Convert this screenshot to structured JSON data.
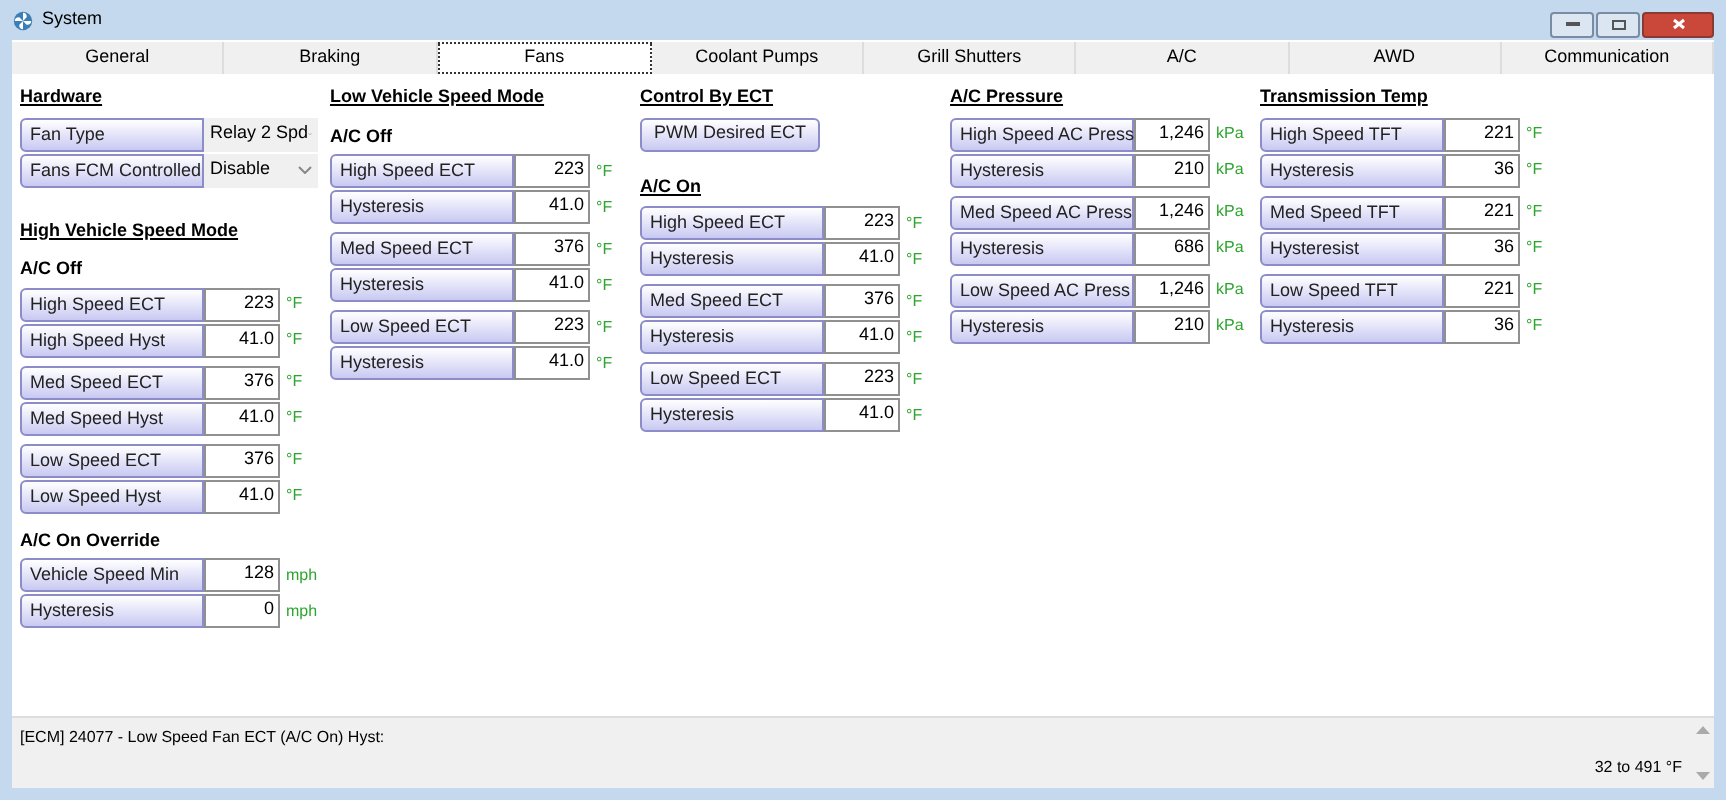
{
  "window": {
    "title": "System"
  },
  "tabs": [
    {
      "label": "General",
      "selected": false
    },
    {
      "label": "Braking",
      "selected": false
    },
    {
      "label": "Fans",
      "selected": true
    },
    {
      "label": "Coolant Pumps",
      "selected": false
    },
    {
      "label": "Grill Shutters",
      "selected": false
    },
    {
      "label": "A/C",
      "selected": false
    },
    {
      "label": "AWD",
      "selected": false
    },
    {
      "label": "Communication",
      "selected": false
    }
  ],
  "columns": [
    {
      "items": [
        {
          "kind": "section",
          "text": "Hardware"
        },
        {
          "kind": "selects",
          "rows": [
            {
              "label": "Fan Type",
              "value": "Relay 2 Spd"
            },
            {
              "label": "Fans FCM Controlled",
              "value": "Disable"
            }
          ]
        },
        {
          "kind": "section",
          "text": "High Vehicle Speed Mode"
        },
        {
          "kind": "subsection",
          "text": "A/C Off"
        },
        {
          "kind": "params",
          "rows": [
            {
              "label": "High Speed ECT",
              "value": "223",
              "unit": "°F"
            },
            {
              "label": "High Speed Hyst",
              "value": "41.0",
              "unit": "°F"
            }
          ]
        },
        {
          "kind": "params",
          "rows": [
            {
              "label": "Med Speed ECT",
              "value": "376",
              "unit": "°F"
            },
            {
              "label": "Med Speed Hyst",
              "value": "41.0",
              "unit": "°F"
            }
          ]
        },
        {
          "kind": "params",
          "rows": [
            {
              "label": "Low Speed ECT",
              "value": "376",
              "unit": "°F"
            },
            {
              "label": "Low Speed Hyst",
              "value": "41.0",
              "unit": "°F"
            }
          ]
        },
        {
          "kind": "subsection",
          "text": "A/C On Override"
        },
        {
          "kind": "params",
          "rows": [
            {
              "label": "Vehicle Speed Min",
              "value": "128",
              "unit": "mph"
            },
            {
              "label": "Hysteresis",
              "value": "0",
              "unit": "mph"
            }
          ]
        }
      ]
    },
    {
      "items": [
        {
          "kind": "section",
          "text": "Low Vehicle Speed Mode"
        },
        {
          "kind": "subsection",
          "text": "A/C Off"
        },
        {
          "kind": "params",
          "rows": [
            {
              "label": "High Speed ECT",
              "value": "223",
              "unit": "°F"
            },
            {
              "label": "Hysteresis",
              "value": "41.0",
              "unit": "°F"
            }
          ]
        },
        {
          "kind": "params",
          "rows": [
            {
              "label": "Med Speed ECT",
              "value": "376",
              "unit": "°F"
            },
            {
              "label": "Hysteresis",
              "value": "41.0",
              "unit": "°F"
            }
          ]
        },
        {
          "kind": "params",
          "rows": [
            {
              "label": "Low Speed ECT",
              "value": "223",
              "unit": "°F"
            },
            {
              "label": "Hysteresis",
              "value": "41.0",
              "unit": "°F"
            }
          ]
        }
      ]
    },
    {
      "items": [
        {
          "kind": "section",
          "text": "Control By ECT"
        },
        {
          "kind": "button",
          "text": "PWM Desired ECT"
        },
        {
          "kind": "section",
          "text": "A/C On"
        },
        {
          "kind": "params",
          "rows": [
            {
              "label": "High Speed ECT",
              "value": "223",
              "unit": "°F"
            },
            {
              "label": "Hysteresis",
              "value": "41.0",
              "unit": "°F"
            }
          ]
        },
        {
          "kind": "params",
          "rows": [
            {
              "label": "Med Speed ECT",
              "value": "376",
              "unit": "°F"
            },
            {
              "label": "Hysteresis",
              "value": "41.0",
              "unit": "°F"
            }
          ]
        },
        {
          "kind": "params",
          "rows": [
            {
              "label": "Low Speed ECT",
              "value": "223",
              "unit": "°F"
            },
            {
              "label": "Hysteresis",
              "value": "41.0",
              "unit": "°F"
            }
          ]
        }
      ]
    },
    {
      "items": [
        {
          "kind": "section",
          "text": "A/C Pressure"
        },
        {
          "kind": "params",
          "rows": [
            {
              "label": "High Speed AC Press",
              "value": "1,246",
              "unit": "kPa"
            },
            {
              "label": "Hysteresis",
              "value": "210",
              "unit": "kPa"
            }
          ]
        },
        {
          "kind": "params",
          "rows": [
            {
              "label": "Med Speed AC Press",
              "value": "1,246",
              "unit": "kPa"
            },
            {
              "label": "Hysteresis",
              "value": "686",
              "unit": "kPa"
            }
          ]
        },
        {
          "kind": "params",
          "rows": [
            {
              "label": "Low Speed AC Press",
              "value": "1,246",
              "unit": "kPa"
            },
            {
              "label": "Hysteresis",
              "value": "210",
              "unit": "kPa"
            }
          ]
        }
      ]
    },
    {
      "items": [
        {
          "kind": "section",
          "text": "Transmission Temp"
        },
        {
          "kind": "params",
          "rows": [
            {
              "label": "High Speed TFT",
              "value": "221",
              "unit": "°F"
            },
            {
              "label": "Hysteresis",
              "value": "36",
              "unit": "°F"
            }
          ]
        },
        {
          "kind": "params",
          "rows": [
            {
              "label": "Med Speed TFT",
              "value": "221",
              "unit": "°F"
            },
            {
              "label": "Hysteresist",
              "value": "36",
              "unit": "°F"
            }
          ]
        },
        {
          "kind": "params",
          "rows": [
            {
              "label": "Low Speed TFT",
              "value": "221",
              "unit": "°F"
            },
            {
              "label": "Hysteresis",
              "value": "36",
              "unit": "°F"
            }
          ]
        }
      ]
    }
  ],
  "status": {
    "message": "[ECM] 24077 - Low Speed Fan ECT (A/C On) Hyst:",
    "range": "32 to 491 °F"
  }
}
